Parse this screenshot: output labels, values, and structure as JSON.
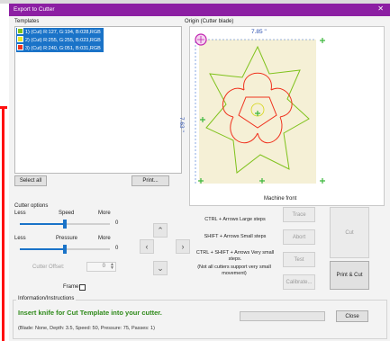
{
  "window": {
    "title": "Export to Cutter",
    "close_glyph": "✕"
  },
  "templates": {
    "heading": "Templates",
    "items": [
      {
        "label": "1) (Cut) R:127, G:194, B:028,RGB",
        "color": "#7fc21c"
      },
      {
        "label": "2) (Cut) R:255, G:255, B:023,RGB",
        "color": "#ffff17"
      },
      {
        "label": "3) (Cut) R:240, G:051, B:031,RGB",
        "color": "#f0331f"
      }
    ],
    "select_all_label": "Select all",
    "print_label": "Print..."
  },
  "preview": {
    "heading": "Origin (Cutter blade)",
    "width_label": "7.85 \"",
    "height_label": "7.63 \"",
    "machine_front_label": "Machine front",
    "colors": {
      "paper": "#f5f0d6",
      "green": "#7fc21c",
      "red": "#f0331f",
      "yellow": "#d6d61a",
      "origin": "#c020b0"
    }
  },
  "cutter_options": {
    "heading": "Cutter options",
    "speed": {
      "label": "Speed",
      "less": "Less",
      "more": "More",
      "value": "0",
      "fraction": 0.5
    },
    "pressure": {
      "label": "Pressure",
      "less": "Less",
      "more": "More",
      "value": "0",
      "fraction": 0.5
    },
    "cutter_offset_label": "Cutter Offset:",
    "cutter_offset_value": "0",
    "frame_label": "Frame"
  },
  "arrows": {
    "up": "⌃",
    "down": "⌄",
    "left": "‹",
    "right": "›"
  },
  "help": {
    "large": "CTRL + Arrows  Large steps",
    "small": "SHIFT + Arrows  Small steps",
    "very_small": "CTRL + SHIFT + Arrows  Very small steps.",
    "note": "(Not all cutters support very small movement)"
  },
  "actions": {
    "trace": "Trace",
    "abort": "Abort",
    "test": "Test",
    "calibrate": "Calibrate...",
    "cut": "Cut",
    "print_cut": "Print & Cut"
  },
  "info": {
    "heading": "Information/Instructions",
    "message": "Insert knife for Cut Template into your cutter.",
    "details": "(Blade: None,  Depth: 3.5, Speed: 50, Pressure: 75, Passes: 1)",
    "close_label": "Close"
  }
}
